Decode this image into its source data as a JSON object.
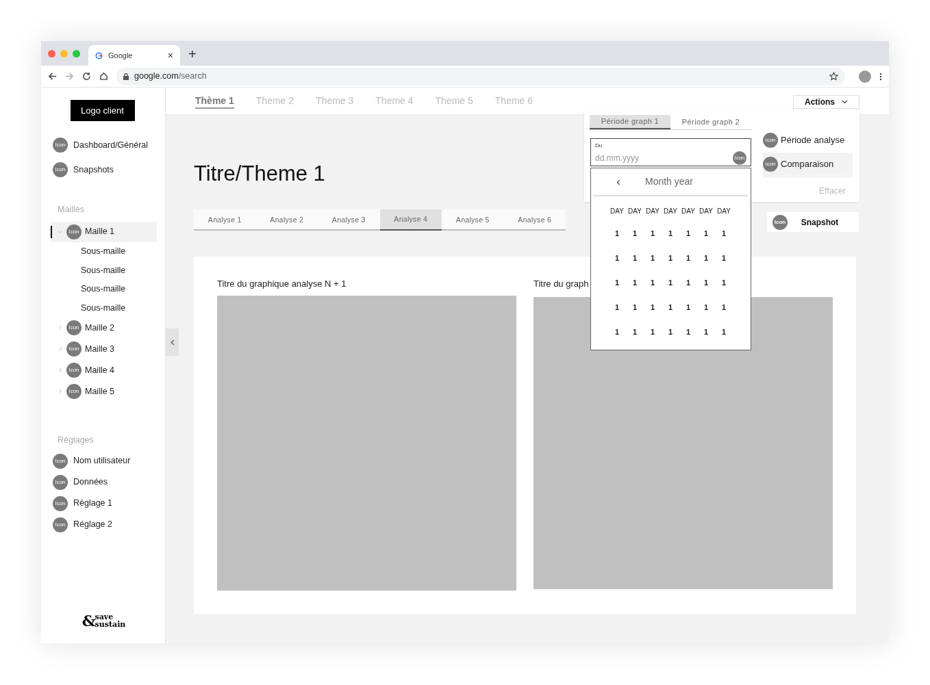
{
  "browser": {
    "tab_title": "Google",
    "tab_close": "×",
    "new_tab": "+",
    "url_host": "google.com",
    "url_path": "/search"
  },
  "sidebar": {
    "logo": "Logo client",
    "nav": [
      {
        "label": "Dashboard/Général",
        "icon": "Icon"
      },
      {
        "label": "Snapshots",
        "icon": "Icon"
      }
    ],
    "mailles_heading": "Mailles",
    "mailles": [
      {
        "label": "Maille 1",
        "icon": "Icon",
        "expanded": true,
        "selected": true,
        "children": [
          {
            "label": "Sous-maille"
          },
          {
            "label": "Sous-maille"
          },
          {
            "label": "Sous-maille"
          },
          {
            "label": "Sous-maille"
          }
        ]
      },
      {
        "label": "Maille 2",
        "icon": "Icon",
        "expanded": false,
        "selected": false
      },
      {
        "label": "Maille 3",
        "icon": "Icon",
        "expanded": false,
        "selected": false
      },
      {
        "label": "Maille 4",
        "icon": "Icon",
        "expanded": false,
        "selected": false
      },
      {
        "label": "Maille 5",
        "icon": "Icon",
        "expanded": false,
        "selected": false
      }
    ],
    "settings_heading": "Réglages",
    "settings": [
      {
        "label": "Nom utilisateur",
        "icon": "Icon"
      },
      {
        "label": "Données",
        "icon": "Icon"
      },
      {
        "label": "Réglage 1",
        "icon": "Icon"
      },
      {
        "label": "Réglage 2",
        "icon": "Icon"
      }
    ],
    "brand_top": "save",
    "brand_bottom": "sustain",
    "brand_amp": "&"
  },
  "theme_tabs": [
    {
      "label": "Thème 1",
      "selected": true
    },
    {
      "label": "Theme 2",
      "selected": false
    },
    {
      "label": "Theme 3",
      "selected": false
    },
    {
      "label": "Theme 4",
      "selected": false
    },
    {
      "label": "Theme 5",
      "selected": false
    },
    {
      "label": "Theme 6",
      "selected": false
    }
  ],
  "actions_button": "Actions",
  "page_title": "Titre/Theme 1",
  "analysis_tabs": [
    {
      "label": "Analyse 1",
      "selected": false
    },
    {
      "label": "Analyse 2",
      "selected": false
    },
    {
      "label": "Analyse 3",
      "selected": false
    },
    {
      "label": "Analyse 4",
      "selected": true
    },
    {
      "label": "Analyse 5",
      "selected": false
    },
    {
      "label": "Analyse 6",
      "selected": false
    }
  ],
  "charts": [
    {
      "title": "Titre du graphique analyse N + 1"
    },
    {
      "title": "Titre du graph"
    }
  ],
  "actions_menu": {
    "period_tabs": [
      {
        "label": "Période graph 1",
        "selected": true
      },
      {
        "label": "Période graph 2",
        "selected": false
      }
    ],
    "options": [
      {
        "label": "Période analyse",
        "icon": "Icon",
        "selected": false
      },
      {
        "label": "Comparaison",
        "icon": "Icon",
        "selected": true
      }
    ],
    "clear": "Effacer"
  },
  "snapshot_button": {
    "label": "Snapshot",
    "icon": "Icon"
  },
  "date_field": {
    "label": "Du",
    "placeholder": "dd.mm.yyyy",
    "icon": "Icon"
  },
  "calendar": {
    "prev": "‹",
    "month": "Month year",
    "weekdays": [
      "DAY",
      "DAY",
      "DAY",
      "DAY",
      "DAY",
      "DAY",
      "DAY"
    ],
    "weeks": [
      [
        "1",
        "1",
        "1",
        "1",
        "1",
        "1",
        "1"
      ],
      [
        "1",
        "1",
        "1",
        "1",
        "1",
        "1",
        "1"
      ],
      [
        "1",
        "1",
        "1",
        "1",
        "1",
        "1",
        "1"
      ],
      [
        "1",
        "1",
        "1",
        "1",
        "1",
        "1",
        "1"
      ],
      [
        "1",
        "1",
        "1",
        "1",
        "1",
        "1",
        "1"
      ]
    ]
  }
}
